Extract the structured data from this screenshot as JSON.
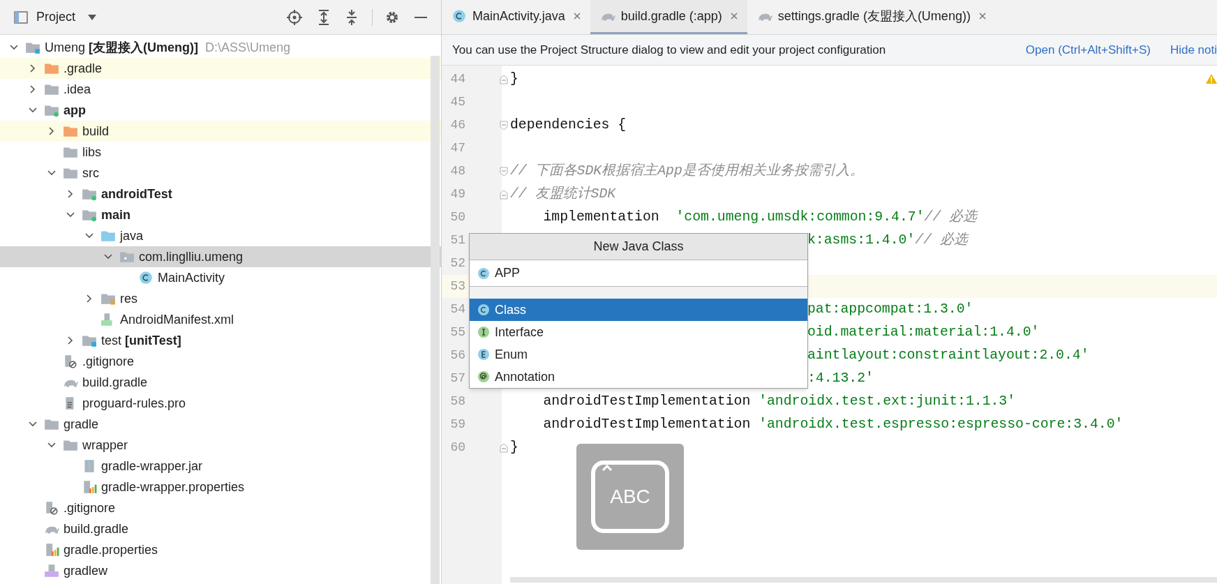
{
  "project_panel": {
    "title": "Project"
  },
  "tree": [
    {
      "label": "Umeng **[友盟接入(Umeng)]**",
      "path": "D:\\ASS\\Umeng",
      "kind": "module-root",
      "bold": false,
      "expanded": true,
      "selected": false,
      "excluded": false,
      "children": [
        {
          "label": ".gradle",
          "kind": "folder-excluded",
          "bold": false,
          "expanded": false,
          "selected": false,
          "excluded": true
        },
        {
          "label": ".idea",
          "kind": "folder",
          "bold": false,
          "expanded": false,
          "selected": false,
          "excluded": false
        },
        {
          "label": "app",
          "kind": "module",
          "bold": true,
          "expanded": true,
          "selected": false,
          "excluded": false,
          "children": [
            {
              "label": "build",
              "kind": "folder-excluded",
              "bold": false,
              "expanded": false,
              "selected": false,
              "excluded": true
            },
            {
              "label": "libs",
              "kind": "folder",
              "bold": false,
              "selected": false,
              "excluded": false
            },
            {
              "label": "src",
              "kind": "folder",
              "bold": false,
              "expanded": true,
              "selected": false,
              "excluded": false,
              "children": [
                {
                  "label": "androidTest",
                  "kind": "module",
                  "bold": true,
                  "expanded": false,
                  "selected": false,
                  "excluded": false
                },
                {
                  "label": "main",
                  "kind": "module",
                  "bold": true,
                  "expanded": true,
                  "selected": false,
                  "excluded": false,
                  "children": [
                    {
                      "label": "java",
                      "kind": "folder-source",
                      "bold": false,
                      "expanded": true,
                      "selected": false,
                      "excluded": false,
                      "children": [
                        {
                          "label": "com.linglliu.umeng",
                          "kind": "package",
                          "bold": false,
                          "expanded": true,
                          "selected": true,
                          "excluded": false,
                          "children": [
                            {
                              "label": "MainActivity",
                              "kind": "class",
                              "bold": false,
                              "selected": false,
                              "excluded": false
                            }
                          ]
                        }
                      ]
                    },
                    {
                      "label": "res",
                      "kind": "folder-resources",
                      "bold": false,
                      "expanded": false,
                      "selected": false,
                      "excluded": false
                    },
                    {
                      "label": "AndroidManifest.xml",
                      "kind": "manifest",
                      "bold": false,
                      "selected": false,
                      "excluded": false
                    }
                  ]
                },
                {
                  "label": "test **[unitTest]**",
                  "kind": "test-folder",
                  "bold": false,
                  "expanded": false,
                  "selected": false,
                  "excluded": false
                }
              ]
            },
            {
              "label": ".gitignore",
              "kind": "ignore",
              "bold": false,
              "selected": false,
              "excluded": false
            },
            {
              "label": "build.gradle",
              "kind": "gradle",
              "bold": false,
              "selected": false,
              "excluded": false
            },
            {
              "label": "proguard-rules.pro",
              "kind": "text",
              "bold": false,
              "selected": false,
              "excluded": false
            }
          ]
        },
        {
          "label": "gradle",
          "kind": "folder",
          "bold": false,
          "expanded": true,
          "selected": false,
          "excluded": false,
          "children": [
            {
              "label": "wrapper",
              "kind": "folder",
              "bold": false,
              "expanded": true,
              "selected": false,
              "excluded": false,
              "children": [
                {
                  "label": "gradle-wrapper.jar",
                  "kind": "jar",
                  "bold": false,
                  "selected": false,
                  "excluded": false
                },
                {
                  "label": "gradle-wrapper.properties",
                  "kind": "properties",
                  "bold": false,
                  "selected": false,
                  "excluded": false
                }
              ]
            }
          ]
        },
        {
          "label": ".gitignore",
          "kind": "ignore",
          "bold": false,
          "selected": false,
          "excluded": false
        },
        {
          "label": "build.gradle",
          "kind": "gradle",
          "bold": false,
          "selected": false,
          "excluded": false
        },
        {
          "label": "gradle.properties",
          "kind": "properties",
          "bold": false,
          "selected": false,
          "excluded": false
        },
        {
          "label": "gradlew",
          "kind": "shell",
          "bold": false,
          "selected": false,
          "excluded": false
        }
      ]
    }
  ],
  "tabs": [
    {
      "label": "MainActivity.java",
      "kind": "class",
      "selected": false
    },
    {
      "label": "build.gradle (:app)",
      "kind": "gradle",
      "selected": true
    },
    {
      "label": "settings.gradle (友盟接入(Umeng))",
      "kind": "gradle",
      "selected": false
    }
  ],
  "notification": {
    "text": "You can use the Project Structure dialog to view and edit your project configuration",
    "links": [
      "Open (Ctrl+Alt+Shift+S)",
      "Hide noti"
    ]
  },
  "code_lines": [
    {
      "number": "44",
      "fold_start": false,
      "fold_end": true,
      "partial": false,
      "current": false,
      "warning": true,
      "tokens": [
        {
          "kind": "plain",
          "text": "}"
        }
      ]
    },
    {
      "number": "45",
      "fold_start": false,
      "fold_end": false,
      "current": false,
      "warning": false
    },
    {
      "number": "46",
      "fold_start": true,
      "fold_end": false,
      "partial": false,
      "current": false,
      "warning": false,
      "tokens": [
        {
          "kind": "plain",
          "text": "dependencies {"
        }
      ]
    },
    {
      "number": "47",
      "fold_start": false,
      "fold_end": false,
      "current": false,
      "warning": false
    },
    {
      "number": "48",
      "fold_start": true,
      "fold_end": false,
      "partial": false,
      "current": false,
      "warning": false,
      "tokens": [
        {
          "kind": "comment",
          "text": "// 下面各SDK根据宿主App是否使用相关业务按需引入。"
        }
      ]
    },
    {
      "number": "49",
      "fold_start": false,
      "fold_end": true,
      "partial": false,
      "current": false,
      "warning": false,
      "tokens": [
        {
          "kind": "comment",
          "text": "// 友盟统计SDK"
        }
      ]
    },
    {
      "number": "50",
      "fold_start": false,
      "fold_end": false,
      "partial": false,
      "current": false,
      "warning": false,
      "tokens": [
        {
          "kind": "plain",
          "text": "    implementation  "
        },
        {
          "kind": "string",
          "text": "'com.umeng.umsdk:common:9.4.7'"
        },
        {
          "kind": "comment",
          "text": "// 必选"
        }
      ]
    },
    {
      "number": "51",
      "partial": true,
      "current": false,
      "warning": false,
      "tokens": [
        {
          "kind": "string",
          "text": "k:asms:1.4.0'"
        },
        {
          "kind": "comment",
          "text": "// 必选"
        }
      ]
    },
    {
      "number": "52",
      "current": false,
      "warning": false
    },
    {
      "number": "53",
      "current": true,
      "warning": false
    },
    {
      "number": "54",
      "partial": true,
      "current": false,
      "warning": false,
      "tokens": [
        {
          "kind": "string",
          "text": "pat:appcompat:1.3.0'"
        }
      ]
    },
    {
      "number": "55",
      "partial": true,
      "current": false,
      "warning": false,
      "tokens": [
        {
          "kind": "string",
          "text": "oid.material:material:1.4.0'"
        }
      ]
    },
    {
      "number": "56",
      "partial": true,
      "current": false,
      "warning": false,
      "tokens": [
        {
          "kind": "string",
          "text": "aintlayout:constraintlayout:2.0.4'"
        }
      ]
    },
    {
      "number": "57",
      "partial": true,
      "current": false,
      "warning": false,
      "tokens": [
        {
          "kind": "string",
          "text": ":4.13.2'"
        }
      ]
    },
    {
      "number": "58",
      "fold_start": false,
      "fold_end": false,
      "partial": false,
      "current": false,
      "warning": false,
      "tokens": [
        {
          "kind": "plain",
          "text": "    androidTestImplementation "
        },
        {
          "kind": "string",
          "text": "'androidx.test.ext:junit:1.1.3'"
        }
      ]
    },
    {
      "number": "59",
      "fold_start": false,
      "fold_end": false,
      "partial": false,
      "current": false,
      "warning": false,
      "tokens": [
        {
          "kind": "plain",
          "text": "    androidTestImplementation "
        },
        {
          "kind": "string",
          "text": "'androidx.test.espresso:espresso-core:3.4.0'"
        }
      ]
    },
    {
      "number": "60",
      "fold_start": false,
      "fold_end": true,
      "partial": false,
      "current": false,
      "warning": false,
      "tokens": [
        {
          "kind": "plain",
          "text": "}"
        }
      ]
    }
  ],
  "new_class_popup": {
    "title": "New Java Class",
    "name_value": "APP",
    "kinds": [
      {
        "label": "Class",
        "kind": "class",
        "selected": true
      },
      {
        "label": "Interface",
        "kind": "interface",
        "selected": false
      },
      {
        "label": "Enum",
        "kind": "enum",
        "selected": false
      },
      {
        "label": "Annotation",
        "kind": "annotation",
        "selected": false
      }
    ]
  },
  "ime_indicator": {
    "label": "ABC"
  }
}
